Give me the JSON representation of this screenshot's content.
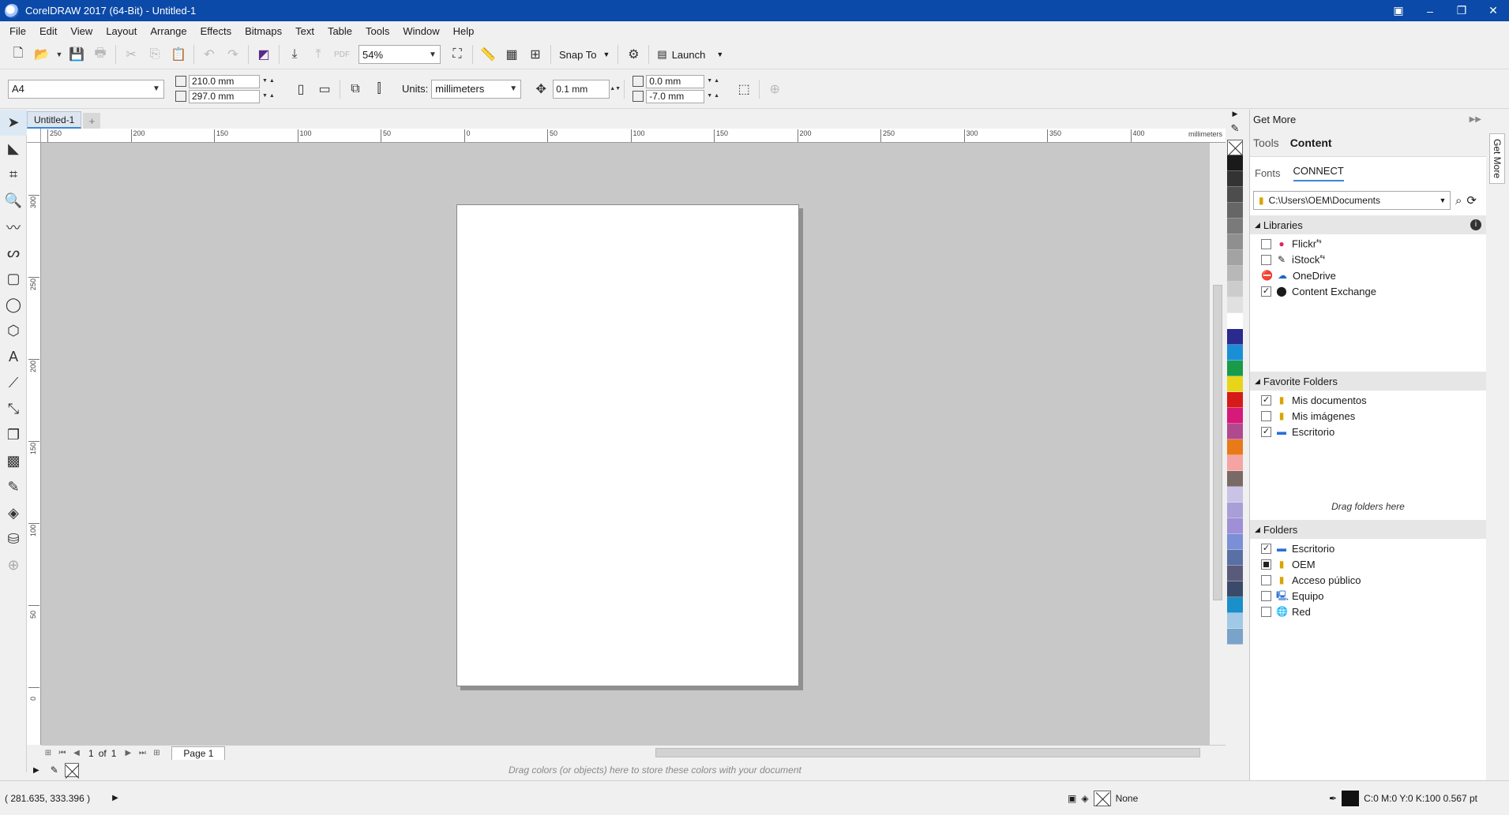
{
  "window": {
    "title": "CorelDRAW 2017 (64-Bit) - Untitled-1",
    "controls": [
      "▣",
      "–",
      "❐",
      "✕"
    ]
  },
  "menu": [
    "File",
    "Edit",
    "View",
    "Layout",
    "Arrange",
    "Effects",
    "Bitmaps",
    "Text",
    "Table",
    "Tools",
    "Window",
    "Help"
  ],
  "toolbar": {
    "zoom": "54%",
    "snap_to": "Snap To",
    "launch": "Launch"
  },
  "property_bar": {
    "page_size": "A4",
    "width": "210.0 mm",
    "height": "297.0 mm",
    "units_label": "Units:",
    "units_value": "millimeters",
    "nudge": "0.1 mm",
    "dup_x": "0.0 mm",
    "dup_y": "-7.0 mm"
  },
  "document_tab": "Untitled-1",
  "ruler": {
    "h_ticks": [
      "250",
      "200",
      "150",
      "100",
      "50",
      "0",
      "50",
      "100",
      "150",
      "200",
      "250",
      "300",
      "350",
      "400"
    ],
    "h_unit": "millimeters",
    "v_ticks": [
      "300",
      "250",
      "200",
      "150",
      "100",
      "50",
      "0"
    ]
  },
  "page_nav": {
    "current": "1",
    "of_label": "of",
    "total": "1",
    "page_tab": "Page 1"
  },
  "doc_palette_hint": "Drag colors (or objects) here to store these colors with your document",
  "palette_colors": [
    "#1a1a1a",
    "#333333",
    "#4d4d4d",
    "#666666",
    "#7a7a7a",
    "#8f8f8f",
    "#a3a3a3",
    "#b8b8b8",
    "#cccccc",
    "#e0e0e0",
    "#ffffff",
    "#2a2a8f",
    "#1a8fd6",
    "#1a9b4a",
    "#e8d51a",
    "#d61a1a",
    "#d61a7a",
    "#b04a8f",
    "#e87a1a",
    "#f5a3a3",
    "#7a6a66",
    "#c9c3e6",
    "#a99fd6",
    "#9f8fd6",
    "#7a8fd6",
    "#5a6fa3",
    "#5a5a7a",
    "#3a4a6a",
    "#1a8fc9",
    "#9fc9e6",
    "#7aa3c9"
  ],
  "docker": {
    "title": "Get More",
    "tabs": [
      "Tools",
      "Content"
    ],
    "subtabs": [
      "Fonts",
      "CONNECT"
    ],
    "path": "C:\\Users\\OEM\\Documents",
    "libraries_header": "Libraries",
    "libraries": [
      {
        "label": "Flickr",
        "checked": false,
        "icon": "flickr-icon"
      },
      {
        "label": "iStock",
        "checked": false,
        "icon": "istock-icon"
      },
      {
        "label": "OneDrive",
        "checked": false,
        "icon": "onedrive-icon"
      },
      {
        "label": "Content Exchange",
        "checked": true,
        "icon": "content-exchange-icon"
      }
    ],
    "favorites_header": "Favorite Folders",
    "favorites": [
      {
        "label": "Mis documentos",
        "checked": true
      },
      {
        "label": "Mis imágenes",
        "checked": false
      },
      {
        "label": "Escritorio",
        "checked": true
      }
    ],
    "drag_hint": "Drag folders here",
    "folders_header": "Folders",
    "folders": [
      {
        "label": "Escritorio",
        "state": "checked"
      },
      {
        "label": "OEM",
        "state": "partial"
      },
      {
        "label": "Acceso público",
        "state": "unchecked"
      },
      {
        "label": "Equipo",
        "state": "unchecked"
      },
      {
        "label": "Red",
        "state": "unchecked"
      }
    ],
    "side_tab": "Get More"
  },
  "status": {
    "coords": "( 281.635, 333.396 )",
    "fill": "None",
    "outline": "C:0 M:0 Y:0 K:100  0.567 pt"
  }
}
